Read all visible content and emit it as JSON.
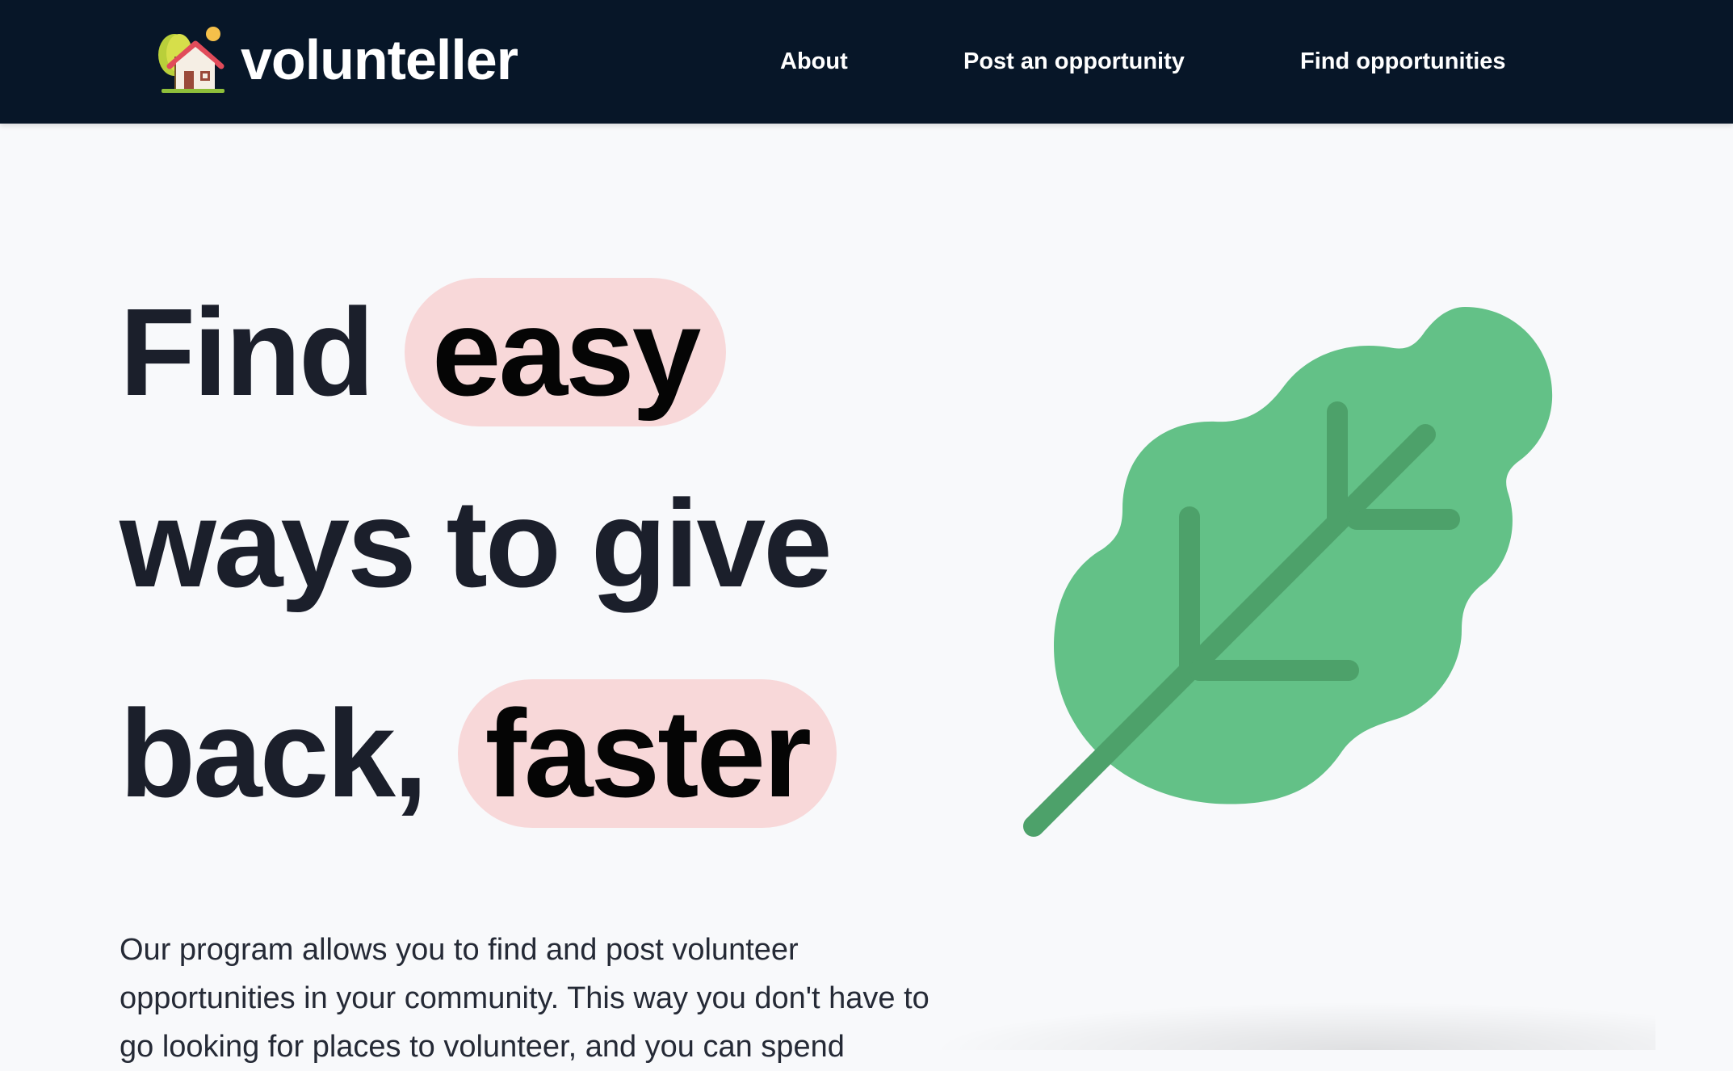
{
  "brand": {
    "name": "volunteller",
    "logo_icon": "house-with-tree-icon"
  },
  "nav": {
    "about_label": "About",
    "post_label": "Post an opportunity",
    "find_label": "Find opportunities"
  },
  "hero": {
    "line1_prefix": "Find",
    "line1_highlight": "easy",
    "line2": "ways to give",
    "line3_prefix": "back,",
    "line3_highlight": "faster",
    "description": "Our program allows you to find and post volunteer opportunities in your community. This way you don't have to go looking for places to volunteer, and you can spend",
    "illustration_icon": "leaf-icon"
  },
  "colors": {
    "navbar_bg": "#071628",
    "page_bg": "#f8f9fb",
    "highlight_bg": "#f8d8d9",
    "leaf_green": "#63c187",
    "leaf_vein": "#4da16a",
    "heading_text": "#1b1f2b"
  }
}
